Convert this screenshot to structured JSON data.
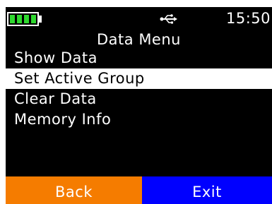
{
  "status_bar": {
    "battery_icon": "battery-full-icon",
    "battery_color": "#2fd82f",
    "battery_level": 1.0,
    "usb_icon": "usb-icon",
    "time": "15:50"
  },
  "menu": {
    "title": "Data Menu",
    "items": [
      {
        "label": "Show Data"
      },
      {
        "label": "Set Active Group"
      },
      {
        "label": "Clear Data"
      },
      {
        "label": "Memory Info"
      }
    ],
    "selected_index": 1
  },
  "softkeys": {
    "back_label": "Back",
    "back_color": "#f57c00",
    "exit_label": "Exit",
    "exit_color": "#0000ff"
  }
}
